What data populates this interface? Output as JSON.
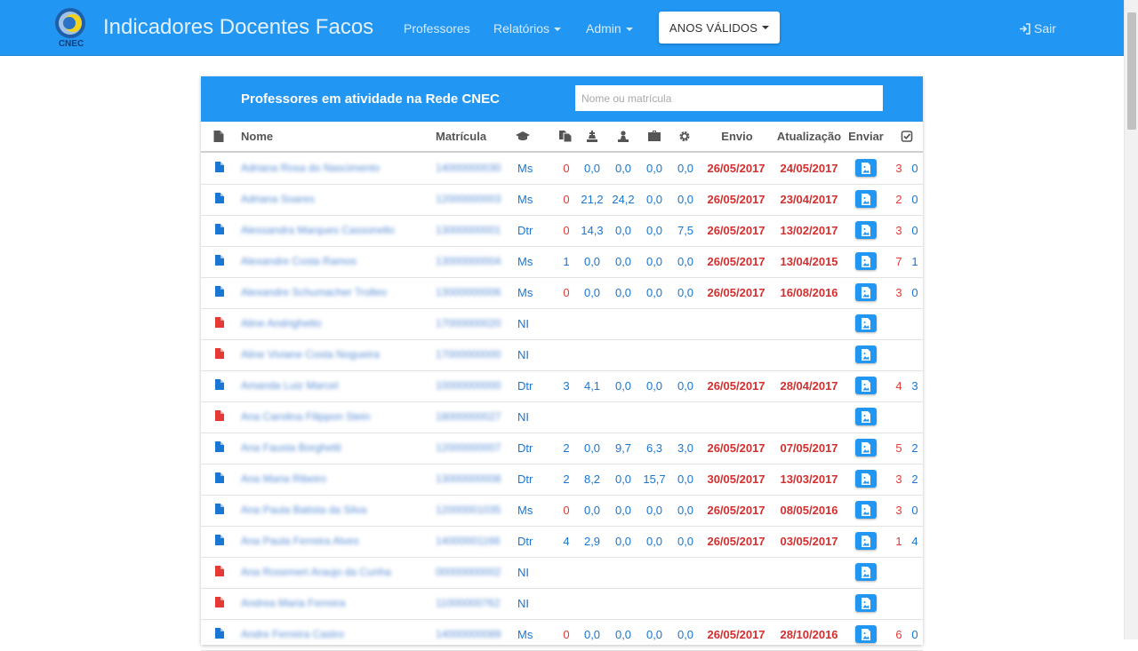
{
  "navbar": {
    "brand": "Indicadores Docentes Facos",
    "logo_text": "CNEC",
    "links": {
      "professores": "Professores",
      "relatorios": "Relatórios",
      "admin": "Admin"
    },
    "anos_button": "ANOS VÁLIDOS",
    "logout": "Sair"
  },
  "panel": {
    "title": "Professores em atividade na Rede CNEC",
    "search_placeholder": "Nome ou matrícula"
  },
  "table": {
    "headers": {
      "nome": "Nome",
      "matricula": "Matrícula",
      "envio": "Envio",
      "atualizacao": "Atualização",
      "enviar": "Enviar"
    },
    "rows": [
      {
        "nome": "Adriana Rosa do Nascimento",
        "matricula": "14000000030",
        "titulo": "Ms",
        "file_color": "blue",
        "n": "0",
        "n_red": true,
        "v1": "0,0",
        "v2": "0,0",
        "v3": "0,0",
        "v4": "0,0",
        "envio": "26/05/2017",
        "atualizacao": "24/05/2017",
        "a": "3",
        "b": "0"
      },
      {
        "nome": "Adriana Soares",
        "matricula": "12000000003",
        "titulo": "Ms",
        "file_color": "blue",
        "n": "0",
        "n_red": true,
        "v1": "21,2",
        "v2": "24,2",
        "v3": "0,0",
        "v4": "0,0",
        "envio": "26/05/2017",
        "atualizacao": "23/04/2017",
        "a": "2",
        "b": "0"
      },
      {
        "nome": "Alessandra Marques Cassonello",
        "matricula": "13000000001",
        "titulo": "Dtr",
        "file_color": "blue",
        "n": "0",
        "n_red": true,
        "v1": "14,3",
        "v2": "0,0",
        "v3": "0,0",
        "v4": "7,5",
        "envio": "26/05/2017",
        "atualizacao": "13/02/2017",
        "a": "3",
        "b": "0"
      },
      {
        "nome": "Alexandre Costa Ramos",
        "matricula": "13000000004",
        "titulo": "Ms",
        "file_color": "blue",
        "n": "1",
        "n_red": false,
        "v1": "0,0",
        "v2": "0,0",
        "v3": "0,0",
        "v4": "0,0",
        "envio": "26/05/2017",
        "atualizacao": "13/04/2015",
        "a": "7",
        "b": "1"
      },
      {
        "nome": "Alexandre Schumacher Trolleo",
        "matricula": "13000000006",
        "titulo": "Ms",
        "file_color": "blue",
        "n": "0",
        "n_red": true,
        "v1": "0,0",
        "v2": "0,0",
        "v3": "0,0",
        "v4": "0,0",
        "envio": "26/05/2017",
        "atualizacao": "16/08/2016",
        "a": "3",
        "b": "0"
      },
      {
        "nome": "Aline Andrighetto",
        "matricula": "17000000020",
        "titulo": "NI",
        "file_color": "red"
      },
      {
        "nome": "Aline Viviane Costa Nogueira",
        "matricula": "17000000000",
        "titulo": "NI",
        "file_color": "red"
      },
      {
        "nome": "Amanda Luiz Marcel",
        "matricula": "10000000000",
        "titulo": "Dtr",
        "file_color": "blue",
        "n": "3",
        "n_red": false,
        "v1": "4,1",
        "v2": "0,0",
        "v3": "0,0",
        "v4": "0,0",
        "envio": "26/05/2017",
        "atualizacao": "28/04/2017",
        "a": "4",
        "b": "3"
      },
      {
        "nome": "Ana Carolina Filippon Stein",
        "matricula": "18000000027",
        "titulo": "NI",
        "file_color": "red"
      },
      {
        "nome": "Ana Fausta Borghetti",
        "matricula": "12000000007",
        "titulo": "Dtr",
        "file_color": "blue",
        "n": "2",
        "n_red": false,
        "v1": "0,0",
        "v2": "9,7",
        "v3": "6,3",
        "v4": "3,0",
        "envio": "26/05/2017",
        "atualizacao": "07/05/2017",
        "a": "5",
        "b": "2"
      },
      {
        "nome": "Ana Maria Ribeiro",
        "matricula": "13000000008",
        "titulo": "Dtr",
        "file_color": "blue",
        "n": "2",
        "n_red": false,
        "v1": "8,2",
        "v2": "0,0",
        "v3": "15,7",
        "v4": "0,0",
        "envio": "30/05/2017",
        "atualizacao": "13/03/2017",
        "a": "3",
        "b": "2"
      },
      {
        "nome": "Ana Paula Batista da Silva",
        "matricula": "12000001035",
        "titulo": "Ms",
        "file_color": "blue",
        "n": "0",
        "n_red": true,
        "v1": "0,0",
        "v2": "0,0",
        "v3": "0,0",
        "v4": "0,0",
        "envio": "26/05/2017",
        "atualizacao": "08/05/2016",
        "a": "3",
        "b": "0"
      },
      {
        "nome": "Ana Paula Ferreira Alves",
        "matricula": "14000001166",
        "titulo": "Dtr",
        "file_color": "blue",
        "n": "4",
        "n_red": false,
        "v1": "2,9",
        "v2": "0,0",
        "v3": "0,0",
        "v4": "0,0",
        "envio": "26/05/2017",
        "atualizacao": "03/05/2017",
        "a": "1",
        "b": "4"
      },
      {
        "nome": "Ana Rosemeri Araujo da Cunha",
        "matricula": "00000000002",
        "titulo": "NI",
        "file_color": "red"
      },
      {
        "nome": "Andrea Maria Ferreira",
        "matricula": "11000000762",
        "titulo": "NI",
        "file_color": "red"
      },
      {
        "nome": "Andre Ferreira Castro",
        "matricula": "14000000089",
        "titulo": "Ms",
        "file_color": "blue",
        "n": "0",
        "n_red": true,
        "v1": "0,0",
        "v2": "0,0",
        "v3": "0,0",
        "v4": "0,0",
        "envio": "26/05/2017",
        "atualizacao": "28/10/2016",
        "a": "6",
        "b": "0"
      }
    ]
  },
  "colors": {
    "primary": "#2196f3",
    "link": "#1976d2",
    "date": "#d32f2f",
    "alert": "#e53935"
  }
}
